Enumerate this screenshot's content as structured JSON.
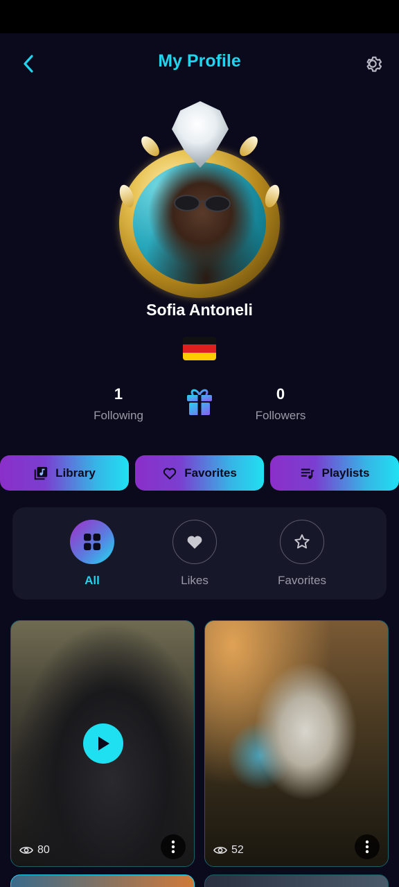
{
  "header": {
    "title": "My Profile"
  },
  "profile": {
    "name": "Sofia Antoneli",
    "country_flag": "germany-flag-icon"
  },
  "stats": {
    "following_count": "1",
    "following_label": "Following",
    "followers_count": "0",
    "followers_label": "Followers"
  },
  "actions": [
    {
      "label": "Library",
      "icon": "library-icon"
    },
    {
      "label": "Favorites",
      "icon": "heart-icon"
    },
    {
      "label": "Playlists",
      "icon": "playlist-icon"
    }
  ],
  "filters": [
    {
      "label": "All",
      "icon": "grid-icon",
      "active": true
    },
    {
      "label": "Likes",
      "icon": "heart-icon",
      "active": false
    },
    {
      "label": "Favorites",
      "icon": "star-icon",
      "active": false
    }
  ],
  "posts": [
    {
      "views": "80",
      "type": "video"
    },
    {
      "views": "52",
      "type": "image"
    }
  ],
  "colors": {
    "background": "#0b0a1c",
    "accent": "#22d3ee",
    "gradient_start": "#8b2fc9",
    "gradient_end": "#20e0f2",
    "panel": "#17172a"
  }
}
